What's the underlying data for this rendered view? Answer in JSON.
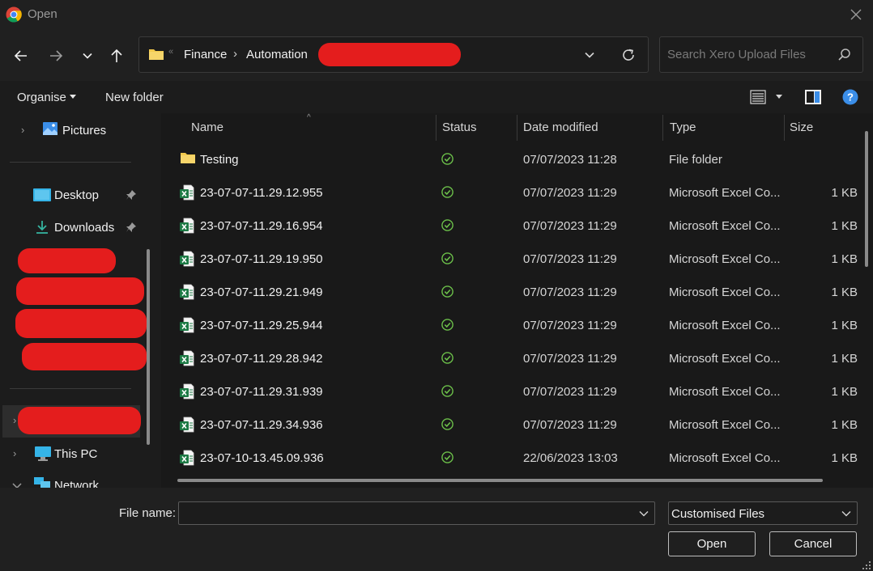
{
  "window": {
    "title": "Open"
  },
  "address": {
    "crumbs": [
      "Finance",
      "Automation"
    ],
    "search_placeholder": "Search Xero Upload Files"
  },
  "toolbar": {
    "organise": "Organise",
    "new_folder": "New folder"
  },
  "sidebar": {
    "pictures": "Pictures",
    "desktop": "Desktop",
    "downloads": "Downloads",
    "this_pc": "This PC",
    "network": "Network"
  },
  "columns": {
    "name": "Name",
    "status": "Status",
    "date": "Date modified",
    "type": "Type",
    "size": "Size"
  },
  "files": [
    {
      "name": "Testing",
      "date": "07/07/2023 11:28",
      "type": "File folder",
      "size": "",
      "icon": "folder-icon"
    },
    {
      "name": "23-07-07-11.29.12.955",
      "date": "07/07/2023 11:29",
      "type": "Microsoft Excel Co...",
      "size": "1 KB",
      "icon": "excel-file-icon"
    },
    {
      "name": "23-07-07-11.29.16.954",
      "date": "07/07/2023 11:29",
      "type": "Microsoft Excel Co...",
      "size": "1 KB",
      "icon": "excel-file-icon"
    },
    {
      "name": "23-07-07-11.29.19.950",
      "date": "07/07/2023 11:29",
      "type": "Microsoft Excel Co...",
      "size": "1 KB",
      "icon": "excel-file-icon"
    },
    {
      "name": "23-07-07-11.29.21.949",
      "date": "07/07/2023 11:29",
      "type": "Microsoft Excel Co...",
      "size": "1 KB",
      "icon": "excel-file-icon"
    },
    {
      "name": "23-07-07-11.29.25.944",
      "date": "07/07/2023 11:29",
      "type": "Microsoft Excel Co...",
      "size": "1 KB",
      "icon": "excel-file-icon"
    },
    {
      "name": "23-07-07-11.29.28.942",
      "date": "07/07/2023 11:29",
      "type": "Microsoft Excel Co...",
      "size": "1 KB",
      "icon": "excel-file-icon"
    },
    {
      "name": "23-07-07-11.29.31.939",
      "date": "07/07/2023 11:29",
      "type": "Microsoft Excel Co...",
      "size": "1 KB",
      "icon": "excel-file-icon"
    },
    {
      "name": "23-07-07-11.29.34.936",
      "date": "07/07/2023 11:29",
      "type": "Microsoft Excel Co...",
      "size": "1 KB",
      "icon": "excel-file-icon"
    },
    {
      "name": "23-07-10-13.45.09.936",
      "date": "22/06/2023 13:03",
      "type": "Microsoft Excel Co...",
      "size": "1 KB",
      "icon": "excel-file-icon"
    }
  ],
  "bottom": {
    "file_name_label": "File name:",
    "file_name_value": "",
    "filter_value": "Customised Files",
    "open_label": "Open",
    "cancel_label": "Cancel"
  },
  "colors": {
    "redaction": "#e41d1d",
    "status_ok": "#6cc04a",
    "excel_green": "#1d7a45",
    "folder_yellow": "#f2c94c",
    "help_blue": "#3b8ee8"
  }
}
